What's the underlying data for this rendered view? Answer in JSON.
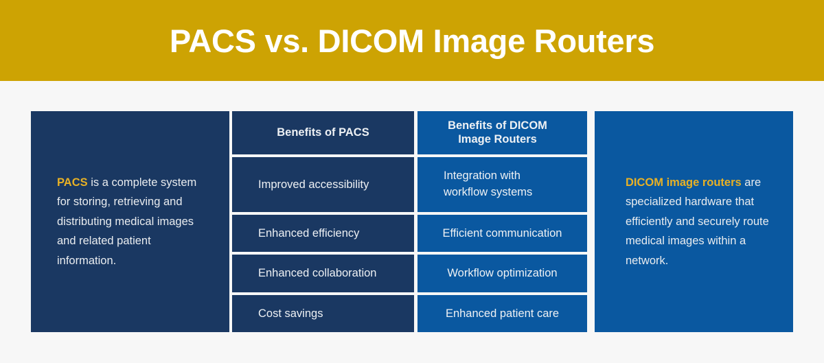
{
  "header": {
    "title": "PACS vs. DICOM Image Routers"
  },
  "left_panel": {
    "accent_term": "PACS",
    "description": " is a complete system for storing, retrieving and distributing medical images and related patient information."
  },
  "right_panel": {
    "accent_term": "DICOM image routers",
    "description": " are specialized hardware that efficiently and securely route medical images within a network."
  },
  "table": {
    "columns": [
      "Benefits of PACS",
      "Benefits of DICOM\nImage Routers"
    ],
    "rows": [
      {
        "pacs": "Improved accessibility",
        "dicom": "Integration with\nworkflow systems",
        "dicom_multiline": true
      },
      {
        "pacs": "Enhanced efficiency",
        "dicom": "Efficient communication",
        "dicom_multiline": false
      },
      {
        "pacs": "Enhanced collaboration",
        "dicom": "Workflow optimization",
        "dicom_multiline": false
      },
      {
        "pacs": "Cost savings",
        "dicom": "Enhanced patient care",
        "dicom_multiline": false
      }
    ]
  },
  "colors": {
    "header_gold": "#cda303",
    "navy": "#1a3862",
    "blue": "#0a58a0",
    "accent_gold": "#e8b125",
    "page_background": "#f7f7f7",
    "text_light": "#eef1f4"
  }
}
